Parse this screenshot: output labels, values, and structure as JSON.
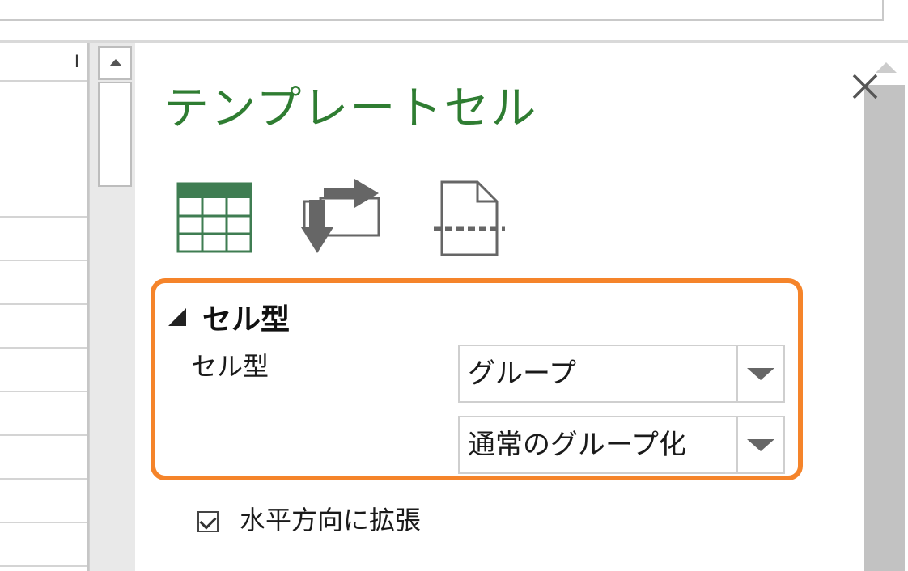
{
  "grid": {
    "column_letter": "I"
  },
  "pane": {
    "title": "テンプレートセル",
    "toolbar_icons": [
      "table-template-icon",
      "transpose-icon",
      "page-break-icon"
    ],
    "section": {
      "header": "セル型",
      "property_label": "セル型",
      "cell_type_value": "グループ",
      "group_mode_value": "通常のグループ化"
    },
    "checkbox": {
      "label": "水平方向に拡張",
      "checked": true
    }
  },
  "colors": {
    "title": "#2f7d32",
    "highlight_border": "#f5842a",
    "table_icon": "#3f7d52"
  }
}
